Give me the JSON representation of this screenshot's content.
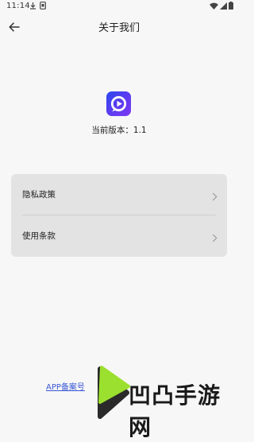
{
  "status_bar": {
    "time": "11:14"
  },
  "header": {
    "title": "关于我们"
  },
  "app_info": {
    "version_label": "当前版本：",
    "version": "1.1"
  },
  "settings": {
    "items": [
      {
        "label": "隐私政策"
      },
      {
        "label": "使用条款"
      }
    ]
  },
  "footer": {
    "icp_link": "APP备案号",
    "watermark": "凹凸手游网"
  },
  "colors": {
    "background": "#f7f7f7",
    "card": "#e3e3e3",
    "link": "#3a57d6",
    "logo_gradient": [
      "#2a49ee",
      "#7c3af2"
    ]
  },
  "icons": [
    "download-icon",
    "sim-icon",
    "wifi-icon",
    "signal-icon",
    "battery-icon",
    "back-arrow-icon",
    "chevron-right-icon",
    "app-logo-icon",
    "watermark-logo-icon"
  ]
}
